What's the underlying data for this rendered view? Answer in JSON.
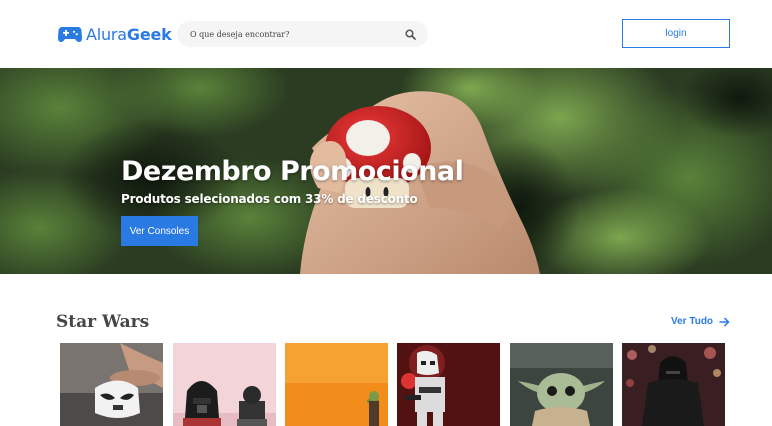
{
  "header": {
    "logo": {
      "brand_light": "Alura",
      "brand_bold": "Geek"
    },
    "search": {
      "placeholder": "O que deseja encontrar?"
    },
    "login_label": "login"
  },
  "hero": {
    "title": "Dezembro Promocional",
    "subtitle": "Produtos selecionados com 33% de desconto",
    "button_label": "Ver Consoles"
  },
  "section": {
    "title": "Star Wars",
    "see_all_label": "Ver Tudo",
    "products": [
      {
        "image": "stormtrooper-bank-photo"
      },
      {
        "image": "darth-vader-lego-photo"
      },
      {
        "image": "yoda-orange-photo"
      },
      {
        "image": "stormtrooper-figure-photo"
      },
      {
        "image": "baby-yoda-photo"
      },
      {
        "image": "kylo-ren-photo"
      }
    ]
  },
  "colors": {
    "accent": "#2A7AE4",
    "title": "#464646",
    "search_bg": "#F5F5F5"
  }
}
